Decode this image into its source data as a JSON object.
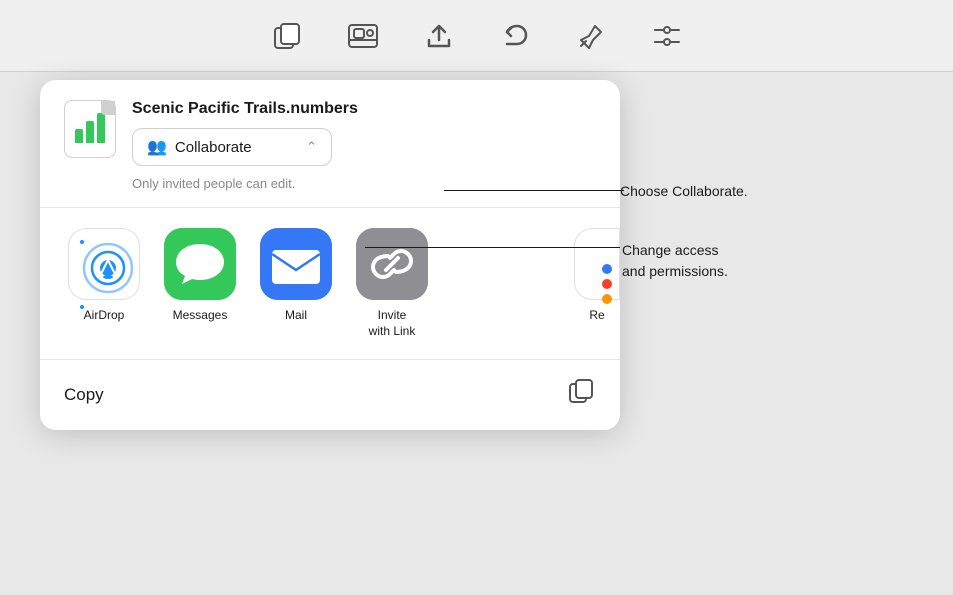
{
  "toolbar": {
    "icons": [
      {
        "name": "copy-icon",
        "symbol": "⧉"
      },
      {
        "name": "media-icon",
        "symbol": "🖼"
      },
      {
        "name": "share-icon",
        "symbol": "⬆"
      },
      {
        "name": "undo-icon",
        "symbol": "↩"
      },
      {
        "name": "pin-icon",
        "symbol": "📌"
      },
      {
        "name": "filter-icon",
        "symbol": "≡"
      }
    ]
  },
  "panel": {
    "file": {
      "name": "Scenic Pacific Trails.numbers",
      "icon_bars": [
        14,
        22,
        30
      ],
      "collaborate_label": "Collaborate",
      "permission_text": "Only invited people can edit.",
      "chevron": "⌃"
    },
    "share_items": [
      {
        "name": "AirDrop",
        "type": "airdrop"
      },
      {
        "name": "Messages",
        "type": "messages",
        "emoji": "💬"
      },
      {
        "name": "Mail",
        "type": "mail",
        "emoji": "✉"
      },
      {
        "name": "Invite\nwith Link",
        "type": "invite",
        "emoji": "🔗"
      }
    ],
    "partial_label": "Re",
    "dots": [
      {
        "color": "#3478f6"
      },
      {
        "color": "#ff3b30"
      },
      {
        "color": "#ff9500"
      }
    ],
    "copy": {
      "label": "Copy",
      "icon": "⧉"
    }
  },
  "annotations": [
    {
      "id": "collaborate",
      "text": "Choose Collaborate."
    },
    {
      "id": "access",
      "text": "Change access\nand permissions."
    }
  ]
}
